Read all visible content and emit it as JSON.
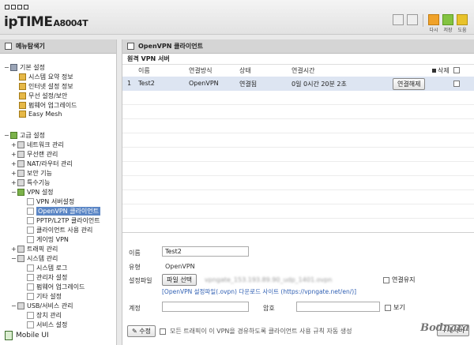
{
  "header": {
    "logo_main": "ipTIME",
    "logo_model": "A8004T",
    "icons": [
      {
        "name": "home-icon"
      },
      {
        "name": "logout-icon"
      }
    ],
    "actions": [
      {
        "name": "refresh-icon",
        "label": "다시",
        "color": "#f0a229"
      },
      {
        "name": "save-icon",
        "label": "저장",
        "color": "#83c341"
      },
      {
        "name": "help-icon",
        "label": "도움",
        "color": "#e8c22a"
      }
    ]
  },
  "sidebar": {
    "title": "메뉴탐색기",
    "basic_group": "기본 설정",
    "basic_items": [
      "시스템 요약 정보",
      "인터넷 설정 정보",
      "무선 설정/보안",
      "펌웨어 업그레이드",
      "Easy Mesh"
    ],
    "advanced_group": "고급 설정",
    "adv_items": [
      "네트워크 관리",
      "무선랜 관리",
      "NAT/라우터 관리",
      "보안 기능",
      "특수기능",
      "VPN 설정"
    ],
    "vpn_items": [
      "VPN 서버설정",
      "OpenVPN 클라이언트",
      "PPTP/L2TP 클라이언트",
      "클라이언트 사용 관리",
      "게이밍 VPN"
    ],
    "adv_items2": [
      "트래픽 관리",
      "시스템 관리"
    ],
    "system_items": [
      "시스템 로그",
      "관리자 설정",
      "펌웨어 업그레이드",
      "기타 설정"
    ],
    "usb_group": "USB/서비스 관리",
    "usb_items": [
      "장치 관리",
      "서비스 설정"
    ],
    "mobile": "Mobile UI"
  },
  "main": {
    "title": "OpenVPN 클라이언트",
    "section": "원격 VPN 서버",
    "columns": {
      "name": "이름",
      "method": "연결방식",
      "status": "상태",
      "time": "연결시간",
      "delete": "삭제"
    },
    "rows": [
      {
        "index": "1",
        "name": "Test2",
        "method": "OpenVPN",
        "status": "연결됨",
        "time": "0일 0시간 20분 2초",
        "action": "연결해제"
      }
    ],
    "form": {
      "name_label": "이름",
      "name_value": "Test2",
      "type_label": "유형",
      "type_value": "OpenVPN",
      "file_label": "설정파일",
      "file_button": "파일 선택",
      "file_name": "vpngate_153.193.89.90_udp_1401.ovpn",
      "keep_label": "연결유지",
      "file_hint": "[OpenVPN 설정파일(.ovpn) 다운로드 사이트 (https://vpngate.net/en/)]",
      "account_label": "계정",
      "password_label": "암호",
      "show_label": "보기",
      "modify_button": "수정",
      "rule_label": "모든 트래픽이 이 VPN을 경유하도록 클라이언트 사용 규칙 자동 생성",
      "new_server_button": "새서버"
    }
  },
  "watermark": "Bodnara"
}
